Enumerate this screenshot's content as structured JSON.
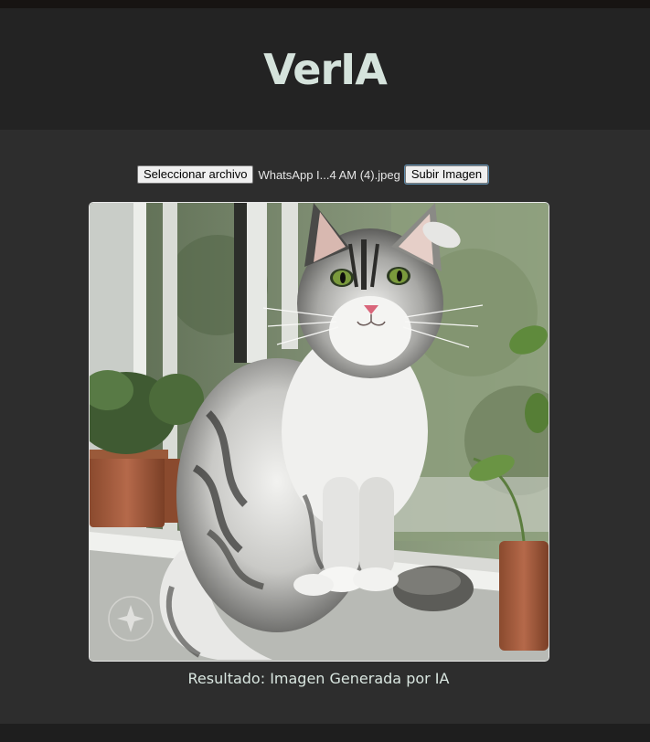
{
  "header": {
    "title": "VerIA"
  },
  "upload": {
    "choose_file_label": "Seleccionar archivo",
    "file_name": "WhatsApp I...4 AM (4).jpeg",
    "submit_label": "Subir Imagen"
  },
  "result": {
    "caption": "Resultado: Imagen Generada por IA",
    "image_alt": "cat-photo"
  },
  "colors": {
    "page_bg": "#2d2d2d",
    "header_bg": "#232323",
    "title_color": "#d5e3dc",
    "footer_bg": "#1e1e1e"
  }
}
